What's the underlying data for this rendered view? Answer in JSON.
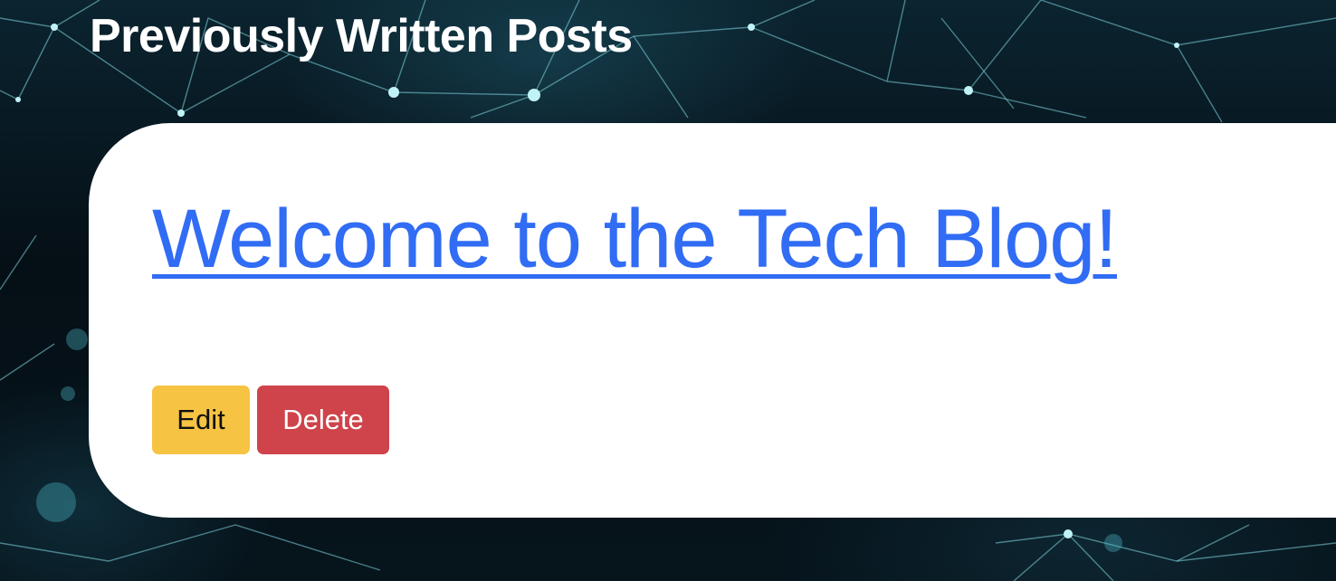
{
  "page": {
    "heading": "Previously Written Posts"
  },
  "posts": [
    {
      "title": "Welcome to the Tech Blog!",
      "edit_label": "Edit",
      "delete_label": "Delete"
    }
  ],
  "colors": {
    "link": "#316cf4",
    "edit_button": "#f6c343",
    "delete_button": "#cf434b",
    "card_background": "#ffffff",
    "page_background": "#05111a"
  },
  "background": {
    "icon": "network-mesh-image"
  }
}
